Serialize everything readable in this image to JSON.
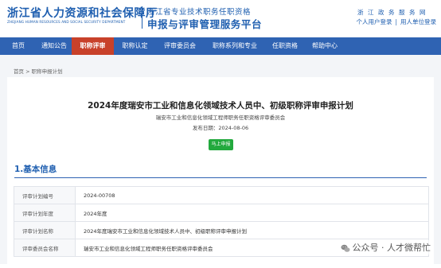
{
  "header": {
    "org_name": "浙江省人力资源和社会保障厅",
    "org_name_en": "ZHEJIANG HUMAN RESOURCES AND SOCIAL SECURITY DEPARTMENT",
    "system_line1": "浙江省专业技术职务任职资格",
    "system_line2": "申报与评审管理服务平台",
    "gov_text": "浙江政务服务网",
    "personal_login": "个人用户登录",
    "employer_login": "用人单位登录",
    "login_separator": "|"
  },
  "nav": {
    "items": [
      "首页",
      "通知公告",
      "职称评审",
      "职称认定",
      "评审委员会",
      "职称系列和专业",
      "任职资格",
      "帮助中心"
    ],
    "active_index": 2,
    "bg_color": "#2f63b3",
    "active_color": "#c8412a"
  },
  "breadcrumb": {
    "home": "首页",
    "separator": ">",
    "current": "职称申报计划"
  },
  "plan": {
    "title": "2024年度瑞安市工业和信息化领域技术人员中、初级职称评审申报计划",
    "committee": "瑞安市工业和信息化领域工程师职务任职资格评审委员会",
    "publish_date": "发布日期：2024-08-06",
    "apply_button": "马上申报"
  },
  "section": {
    "title": "1.基本信息"
  },
  "info_rows": [
    {
      "label": "评审计划编号",
      "value": "2024-00708"
    },
    {
      "label": "评审计划年度",
      "value": "2024年度"
    },
    {
      "label": "评审计划名称",
      "value": "2024年度瑞安市工业和信息化领域技术人员中、初级职称评审申报计划"
    },
    {
      "label": "评审委员会名称",
      "value": "瑞安市工业和信息化领域工程师职务任职资格评审委员会"
    }
  ],
  "watermark": {
    "text": "公众号 · 人才微帮忙",
    "icon": "wechat-icon"
  }
}
